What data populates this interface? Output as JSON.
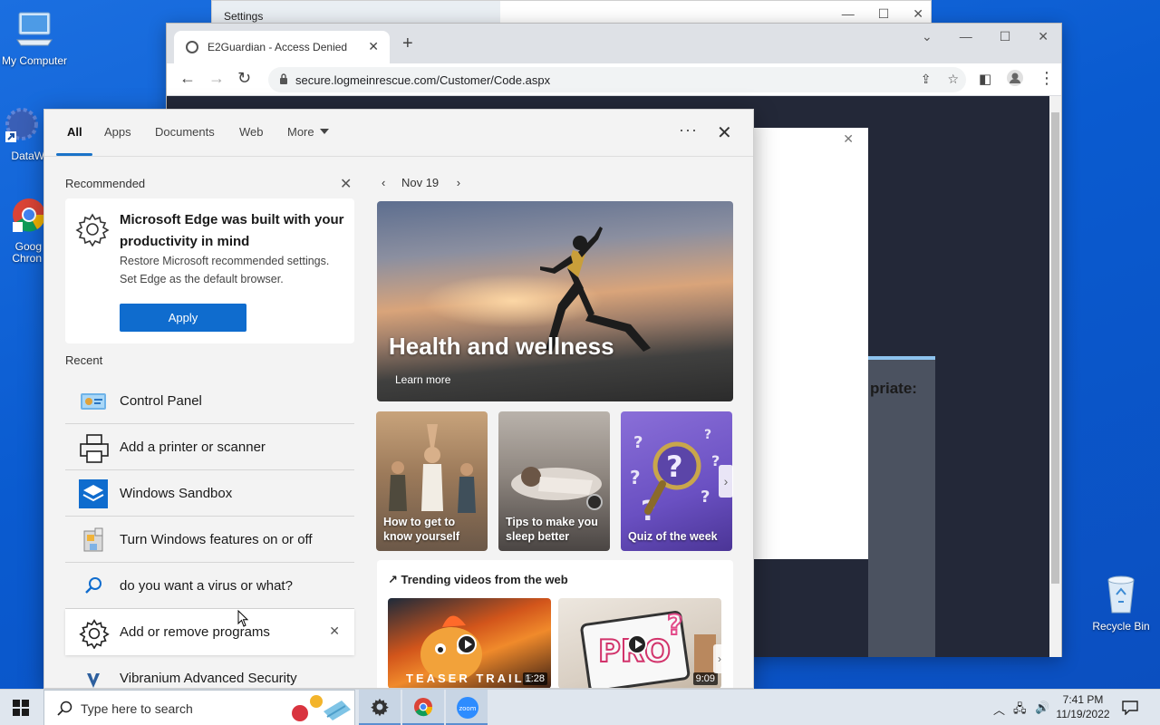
{
  "desktop": {
    "icons": [
      {
        "label": "My Computer"
      },
      {
        "label": "DataWag"
      },
      {
        "label": "Goog Chron"
      },
      {
        "label": "Recycle Bin"
      }
    ]
  },
  "settings_window": {
    "title": "Settings"
  },
  "chrome": {
    "tab_title": "E2Guardian - Access Denied",
    "url": "secure.logmeinrescue.com/Customer/Code.aspx",
    "page_partial_text": "priate:"
  },
  "flyout": {
    "tabs": [
      "All",
      "Apps",
      "Documents",
      "Web",
      "More"
    ],
    "active_tab": "All",
    "recommended": {
      "label": "Recommended",
      "title": "Microsoft Edge was built with your productivity in mind",
      "body": "Restore Microsoft recommended settings. Set Edge as the default browser.",
      "button": "Apply"
    },
    "recent": {
      "label": "Recent",
      "items": [
        {
          "label": "Control Panel",
          "icon": "control-panel-icon"
        },
        {
          "label": "Add a printer or scanner",
          "icon": "printer-icon"
        },
        {
          "label": "Windows Sandbox",
          "icon": "sandbox-icon"
        },
        {
          "label": "Turn Windows features on or off",
          "icon": "windows-features-icon"
        },
        {
          "label": "do you want a virus or what?",
          "icon": "search-icon"
        },
        {
          "label": "Add or remove programs",
          "icon": "gear-icon"
        },
        {
          "label": "Vibranium Advanced Security",
          "icon": "vibranium-icon"
        }
      ]
    },
    "date": "Nov 19",
    "hero": {
      "title": "Health and wellness",
      "link": "Learn more"
    },
    "tiles": [
      {
        "caption": "How to get to know yourself"
      },
      {
        "caption": "Tips to make you sleep better"
      },
      {
        "caption": "Quiz of the week"
      }
    ],
    "trending": {
      "title": "Trending videos from the web",
      "videos": [
        {
          "overlay": "TEASER TRAILE",
          "duration": "1:28"
        },
        {
          "overlay": "",
          "duration": "9:09"
        }
      ]
    }
  },
  "taskbar": {
    "search_placeholder": "Type here to search",
    "time": "7:41 PM",
    "date": "11/19/2022",
    "apps": [
      "settings-icon",
      "chrome-icon",
      "zoom-icon"
    ],
    "zoom_label": "zoom"
  }
}
